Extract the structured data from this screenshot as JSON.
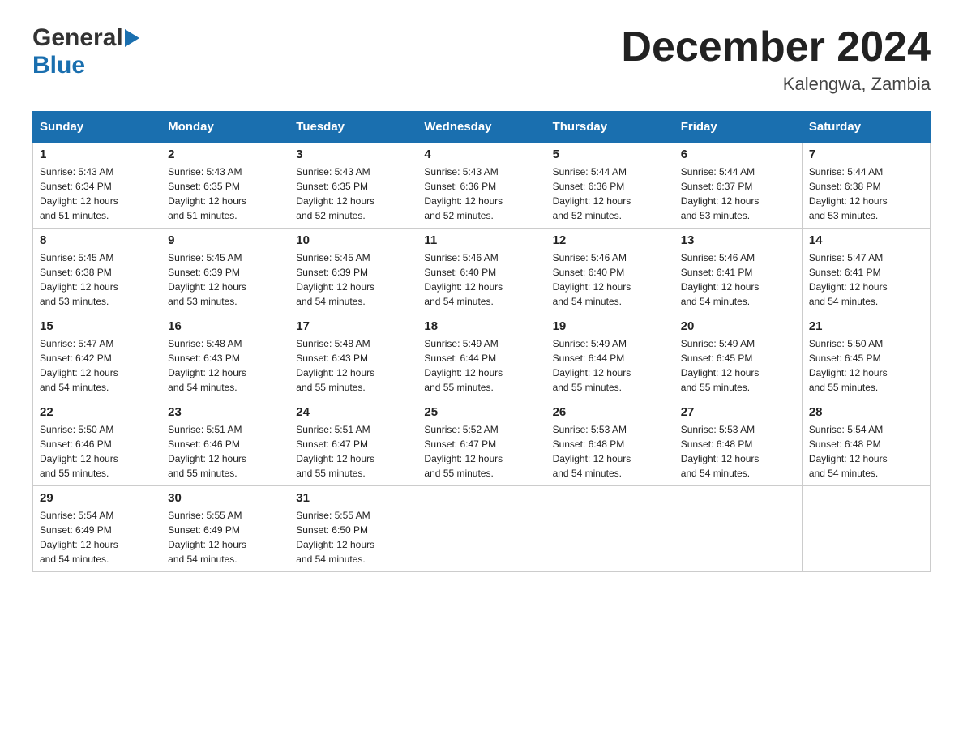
{
  "header": {
    "logo_general": "General",
    "logo_blue": "Blue",
    "month_title": "December 2024",
    "location": "Kalengwa, Zambia"
  },
  "days_of_week": [
    "Sunday",
    "Monday",
    "Tuesday",
    "Wednesday",
    "Thursday",
    "Friday",
    "Saturday"
  ],
  "weeks": [
    [
      {
        "day": "1",
        "sunrise": "5:43 AM",
        "sunset": "6:34 PM",
        "daylight": "12 hours and 51 minutes."
      },
      {
        "day": "2",
        "sunrise": "5:43 AM",
        "sunset": "6:35 PM",
        "daylight": "12 hours and 51 minutes."
      },
      {
        "day": "3",
        "sunrise": "5:43 AM",
        "sunset": "6:35 PM",
        "daylight": "12 hours and 52 minutes."
      },
      {
        "day": "4",
        "sunrise": "5:43 AM",
        "sunset": "6:36 PM",
        "daylight": "12 hours and 52 minutes."
      },
      {
        "day": "5",
        "sunrise": "5:44 AM",
        "sunset": "6:36 PM",
        "daylight": "12 hours and 52 minutes."
      },
      {
        "day": "6",
        "sunrise": "5:44 AM",
        "sunset": "6:37 PM",
        "daylight": "12 hours and 53 minutes."
      },
      {
        "day": "7",
        "sunrise": "5:44 AM",
        "sunset": "6:38 PM",
        "daylight": "12 hours and 53 minutes."
      }
    ],
    [
      {
        "day": "8",
        "sunrise": "5:45 AM",
        "sunset": "6:38 PM",
        "daylight": "12 hours and 53 minutes."
      },
      {
        "day": "9",
        "sunrise": "5:45 AM",
        "sunset": "6:39 PM",
        "daylight": "12 hours and 53 minutes."
      },
      {
        "day": "10",
        "sunrise": "5:45 AM",
        "sunset": "6:39 PM",
        "daylight": "12 hours and 54 minutes."
      },
      {
        "day": "11",
        "sunrise": "5:46 AM",
        "sunset": "6:40 PM",
        "daylight": "12 hours and 54 minutes."
      },
      {
        "day": "12",
        "sunrise": "5:46 AM",
        "sunset": "6:40 PM",
        "daylight": "12 hours and 54 minutes."
      },
      {
        "day": "13",
        "sunrise": "5:46 AM",
        "sunset": "6:41 PM",
        "daylight": "12 hours and 54 minutes."
      },
      {
        "day": "14",
        "sunrise": "5:47 AM",
        "sunset": "6:41 PM",
        "daylight": "12 hours and 54 minutes."
      }
    ],
    [
      {
        "day": "15",
        "sunrise": "5:47 AM",
        "sunset": "6:42 PM",
        "daylight": "12 hours and 54 minutes."
      },
      {
        "day": "16",
        "sunrise": "5:48 AM",
        "sunset": "6:43 PM",
        "daylight": "12 hours and 54 minutes."
      },
      {
        "day": "17",
        "sunrise": "5:48 AM",
        "sunset": "6:43 PM",
        "daylight": "12 hours and 55 minutes."
      },
      {
        "day": "18",
        "sunrise": "5:49 AM",
        "sunset": "6:44 PM",
        "daylight": "12 hours and 55 minutes."
      },
      {
        "day": "19",
        "sunrise": "5:49 AM",
        "sunset": "6:44 PM",
        "daylight": "12 hours and 55 minutes."
      },
      {
        "day": "20",
        "sunrise": "5:49 AM",
        "sunset": "6:45 PM",
        "daylight": "12 hours and 55 minutes."
      },
      {
        "day": "21",
        "sunrise": "5:50 AM",
        "sunset": "6:45 PM",
        "daylight": "12 hours and 55 minutes."
      }
    ],
    [
      {
        "day": "22",
        "sunrise": "5:50 AM",
        "sunset": "6:46 PM",
        "daylight": "12 hours and 55 minutes."
      },
      {
        "day": "23",
        "sunrise": "5:51 AM",
        "sunset": "6:46 PM",
        "daylight": "12 hours and 55 minutes."
      },
      {
        "day": "24",
        "sunrise": "5:51 AM",
        "sunset": "6:47 PM",
        "daylight": "12 hours and 55 minutes."
      },
      {
        "day": "25",
        "sunrise": "5:52 AM",
        "sunset": "6:47 PM",
        "daylight": "12 hours and 55 minutes."
      },
      {
        "day": "26",
        "sunrise": "5:53 AM",
        "sunset": "6:48 PM",
        "daylight": "12 hours and 54 minutes."
      },
      {
        "day": "27",
        "sunrise": "5:53 AM",
        "sunset": "6:48 PM",
        "daylight": "12 hours and 54 minutes."
      },
      {
        "day": "28",
        "sunrise": "5:54 AM",
        "sunset": "6:48 PM",
        "daylight": "12 hours and 54 minutes."
      }
    ],
    [
      {
        "day": "29",
        "sunrise": "5:54 AM",
        "sunset": "6:49 PM",
        "daylight": "12 hours and 54 minutes."
      },
      {
        "day": "30",
        "sunrise": "5:55 AM",
        "sunset": "6:49 PM",
        "daylight": "12 hours and 54 minutes."
      },
      {
        "day": "31",
        "sunrise": "5:55 AM",
        "sunset": "6:50 PM",
        "daylight": "12 hours and 54 minutes."
      },
      null,
      null,
      null,
      null
    ]
  ],
  "labels": {
    "sunrise": "Sunrise:",
    "sunset": "Sunset:",
    "daylight": "Daylight:"
  },
  "colors": {
    "header_bg": "#1a6faf",
    "border": "#ccc"
  }
}
